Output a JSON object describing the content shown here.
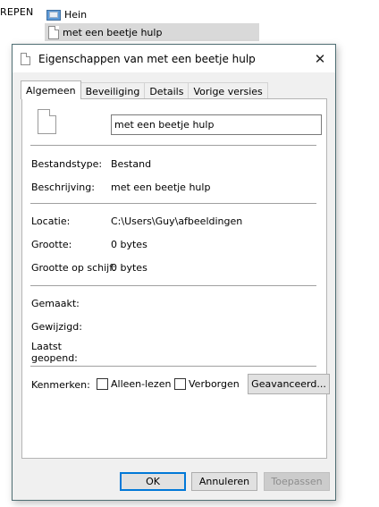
{
  "background": {
    "breadcrumb": "REPEN",
    "folder_item": "Hein",
    "file_item": "met een beetje hulp"
  },
  "dialog": {
    "title": "Eigenschappen van met een beetje hulp",
    "close_glyph": "✕",
    "tabs": [
      {
        "label": "Algemeen",
        "active": true
      },
      {
        "label": "Beveiliging",
        "active": false
      },
      {
        "label": "Details",
        "active": false
      },
      {
        "label": "Vorige versies",
        "active": false
      }
    ],
    "file_name_value": "met een beetje hulp",
    "fields": {
      "type_label": "Bestandstype:",
      "type_value": "Bestand",
      "description_label": "Beschrijving:",
      "description_value": "met een beetje hulp",
      "location_label": "Locatie:",
      "location_value": "C:\\Users\\Guy\\afbeeldingen",
      "size_label": "Grootte:",
      "size_value": "0 bytes",
      "size_on_disk_label": "Grootte op schijf:",
      "size_on_disk_value": "0 bytes",
      "created_label": "Gemaakt:",
      "modified_label": "Gewijzigd:",
      "accessed_label_line1": "Laatst",
      "accessed_label_line2": "geopend:"
    },
    "attributes": {
      "label": "Kenmerken:",
      "readonly_label": "Alleen-lezen",
      "hidden_label": "Verborgen",
      "advanced_button": "Geavanceerd..."
    },
    "buttons": {
      "ok": "OK",
      "cancel": "Annuleren",
      "apply": "Toepassen"
    }
  }
}
